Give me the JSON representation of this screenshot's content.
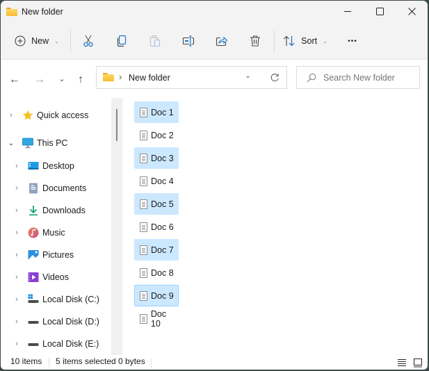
{
  "window": {
    "title": "New folder",
    "controls": {
      "minimize_icon": "minimize-icon",
      "maximize_icon": "maximize-icon",
      "close_icon": "close-icon"
    }
  },
  "toolbar": {
    "new_label": "New",
    "sort_label": "Sort",
    "more_label": "•••",
    "buttons": [
      "cut",
      "copy",
      "paste",
      "rename",
      "share",
      "delete"
    ]
  },
  "navigation": {
    "back": "←",
    "forward": "→",
    "recent": "⌄",
    "up": "↑"
  },
  "address": {
    "separator": "›",
    "path": "New folder"
  },
  "search": {
    "placeholder": "Search New folder"
  },
  "sidebar": {
    "quick_access": "Quick access",
    "this_pc": "This PC",
    "items": [
      {
        "label": "Desktop",
        "icon": "desktop-icon"
      },
      {
        "label": "Documents",
        "icon": "documents-icon"
      },
      {
        "label": "Downloads",
        "icon": "downloads-icon"
      },
      {
        "label": "Music",
        "icon": "music-icon"
      },
      {
        "label": "Pictures",
        "icon": "pictures-icon"
      },
      {
        "label": "Videos",
        "icon": "videos-icon"
      },
      {
        "label": "Local Disk (C:)",
        "icon": "system-drive-icon"
      },
      {
        "label": "Local Disk (D:)",
        "icon": "drive-icon"
      },
      {
        "label": "Local Disk (E:)",
        "icon": "drive-icon"
      }
    ]
  },
  "files": [
    {
      "name": "Doc 1",
      "selected": true
    },
    {
      "name": "Doc 2",
      "selected": false
    },
    {
      "name": "Doc 3",
      "selected": true
    },
    {
      "name": "Doc 4",
      "selected": false
    },
    {
      "name": "Doc 5",
      "selected": true
    },
    {
      "name": "Doc 6",
      "selected": false
    },
    {
      "name": "Doc 7",
      "selected": true
    },
    {
      "name": "Doc 8",
      "selected": false
    },
    {
      "name": "Doc 9",
      "selected": true,
      "focused": true
    },
    {
      "name": "Doc 10",
      "selected": false
    }
  ],
  "status": {
    "item_count": "10 items",
    "selection": "5 items selected",
    "size": "0 bytes"
  },
  "colors": {
    "selection": "#cce8ff",
    "focus_border": "#99d1ff",
    "accent": "#0067c0"
  }
}
